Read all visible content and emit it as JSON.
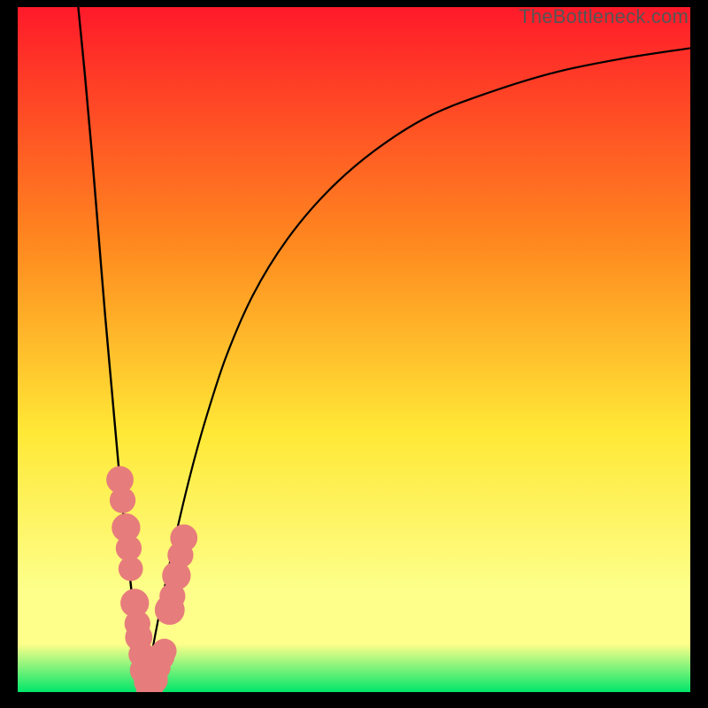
{
  "watermark": "TheBottleneck.com",
  "colors": {
    "red": "#ff1a2a",
    "orange": "#ff8a1f",
    "yellow": "#ffe836",
    "lemon": "#fdff8a",
    "green": "#00e66a",
    "curve": "#000000",
    "dots": "#e77c7c",
    "frame": "#000000"
  },
  "chart_data": {
    "type": "line",
    "title": "",
    "xlabel": "",
    "ylabel": "",
    "xlim": [
      0,
      100
    ],
    "ylim": [
      0,
      100
    ],
    "notch_x": 19,
    "curves": [
      {
        "name": "left",
        "comment": "descending branch from top-left into the notch",
        "x": [
          9,
          10,
          11,
          12,
          13,
          14,
          15,
          16,
          17,
          18,
          19
        ],
        "y": [
          100,
          90,
          79,
          67,
          55,
          44,
          33,
          23,
          14,
          6,
          0
        ]
      },
      {
        "name": "right",
        "comment": "ascending saturating branch from the notch to the right edge",
        "x": [
          19,
          20,
          22,
          24,
          26,
          28,
          31,
          35,
          40,
          46,
          53,
          61,
          70,
          80,
          90,
          100
        ],
        "y": [
          0,
          6,
          16,
          25,
          33,
          40,
          49,
          58,
          66,
          73,
          79,
          84,
          87.5,
          90.5,
          92.5,
          94
        ]
      }
    ],
    "dots": {
      "comment": "salmon bead clusters near the notch, both branches",
      "points": [
        {
          "x": 15.2,
          "y": 31,
          "r": 1.5
        },
        {
          "x": 15.6,
          "y": 28,
          "r": 1.4
        },
        {
          "x": 16.1,
          "y": 24,
          "r": 1.6
        },
        {
          "x": 16.5,
          "y": 21,
          "r": 1.4
        },
        {
          "x": 16.8,
          "y": 18,
          "r": 1.3
        },
        {
          "x": 17.4,
          "y": 13,
          "r": 1.6
        },
        {
          "x": 17.8,
          "y": 10,
          "r": 1.4
        },
        {
          "x": 18.0,
          "y": 8,
          "r": 1.5
        },
        {
          "x": 18.4,
          "y": 5.5,
          "r": 1.4
        },
        {
          "x": 18.8,
          "y": 3.2,
          "r": 1.6
        },
        {
          "x": 19.2,
          "y": 1.5,
          "r": 1.4
        },
        {
          "x": 19.6,
          "y": 0.6,
          "r": 1.5
        },
        {
          "x": 20.2,
          "y": 1.8,
          "r": 1.6
        },
        {
          "x": 20.8,
          "y": 3.6,
          "r": 1.4
        },
        {
          "x": 21.3,
          "y": 5.2,
          "r": 1.5
        },
        {
          "x": 21.8,
          "y": 6.0,
          "r": 1.3
        },
        {
          "x": 22.6,
          "y": 12,
          "r": 1.7
        },
        {
          "x": 23.0,
          "y": 14,
          "r": 1.4
        },
        {
          "x": 23.6,
          "y": 17,
          "r": 1.6
        },
        {
          "x": 24.2,
          "y": 20,
          "r": 1.4
        },
        {
          "x": 24.7,
          "y": 22.5,
          "r": 1.5
        }
      ]
    }
  }
}
